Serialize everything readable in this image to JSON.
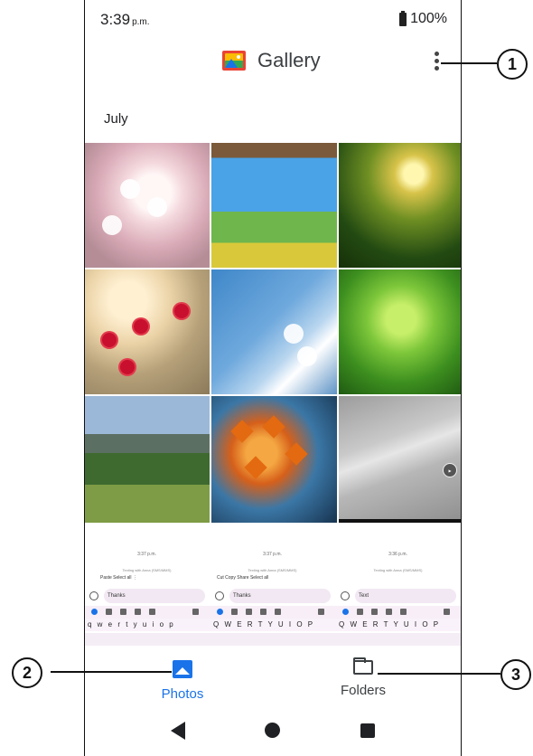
{
  "status_bar": {
    "time": "3:39",
    "ampm": "p.m.",
    "battery": "100%"
  },
  "app_bar": {
    "title": "Gallery"
  },
  "section": {
    "month": "July"
  },
  "photos": [
    {
      "name": "cherry-blossom"
    },
    {
      "name": "meadow-flowers"
    },
    {
      "name": "forest-steps"
    },
    {
      "name": "red-flowers"
    },
    {
      "name": "white-blossom-sky"
    },
    {
      "name": "green-maple"
    },
    {
      "name": "alpine-meadow"
    },
    {
      "name": "autumn-leaves"
    },
    {
      "name": "video-gray"
    }
  ],
  "keyboard_previews": [
    {
      "time": "3:37 p.m.",
      "sub": "Texting with Anna (SMS/MMS)",
      "menu": "Paste   Select all   ⋮",
      "field": "Thanks",
      "keys": "q w e r t y u i o p"
    },
    {
      "time": "3:37 p.m.",
      "sub": "Texting with Anna (SMS/MMS)",
      "menu": "Cut   Copy   Share   Select all",
      "field": "Thanks",
      "keys": "Q W E R T Y U I O P"
    },
    {
      "time": "3:36 p.m.",
      "sub": "Texting with Anna (SMS/MMS)",
      "menu": "",
      "field": "Text",
      "keys": "Q W E R T Y U I O P"
    }
  ],
  "bottom_nav": {
    "photos_label": "Photos",
    "folders_label": "Folders"
  },
  "callouts": {
    "c1": "1",
    "c2": "2",
    "c3": "3"
  },
  "colors": {
    "accent": "#1a73e8"
  }
}
